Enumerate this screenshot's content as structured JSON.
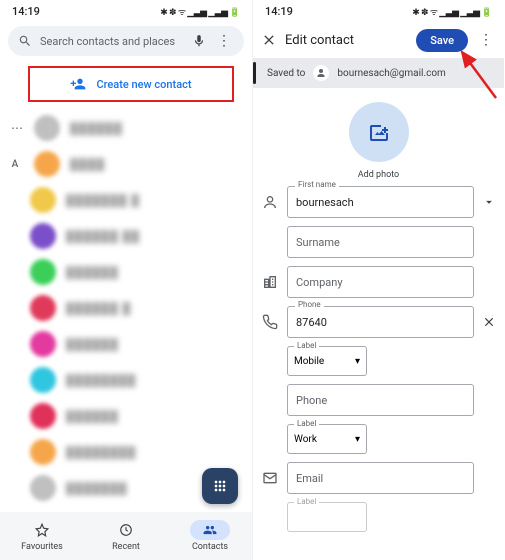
{
  "status": {
    "time": "14:19",
    "indicators": "✱ ✽ ᯤ ▁▃▅ ▁▃▅ 🔋"
  },
  "left": {
    "search_placeholder": "Search contacts and places",
    "create_label": "Create new contact",
    "section_dots": "⋯",
    "section_a": "A",
    "contacts": [
      {
        "color": "#c0c0c0",
        "name": "██████"
      },
      {
        "color": "#f6a64a",
        "name": "████"
      },
      {
        "color": "#f0c94a",
        "name": "███████ █"
      },
      {
        "color": "#7b4fc9",
        "name": "██████ ██"
      },
      {
        "color": "#3bcf5a",
        "name": "██████"
      },
      {
        "color": "#e03a5a",
        "name": "██████ █"
      },
      {
        "color": "#e33aa0",
        "name": "██████"
      },
      {
        "color": "#2fc6e0",
        "name": "████████"
      },
      {
        "color": "#e0315a",
        "name": "██████"
      },
      {
        "color": "#f6a64a",
        "name": "████████"
      },
      {
        "color": "#c0c0c0",
        "name": "███████"
      }
    ],
    "nav": {
      "fav": "Favourites",
      "recent": "Recent",
      "contacts": "Contacts"
    }
  },
  "right": {
    "title": "Edit contact",
    "save": "Save",
    "saved_to": "Saved to",
    "account": "bournesach@gmail.com",
    "add_photo": "Add photo",
    "labels": {
      "first_name": "First name",
      "surname_ph": "Surname",
      "company_ph": "Company",
      "phone": "Phone",
      "label": "Label",
      "mobile": "Mobile",
      "phone_ph": "Phone",
      "work": "Work",
      "email_ph": "Email"
    },
    "values": {
      "first_name": "bournesach",
      "phone1": "87640"
    }
  }
}
